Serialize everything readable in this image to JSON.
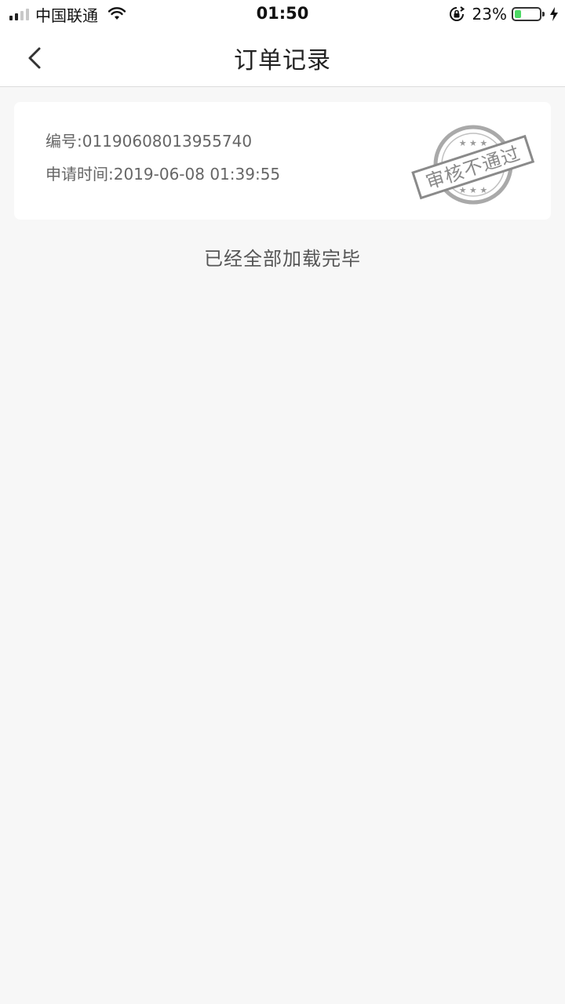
{
  "status_bar": {
    "carrier": "中国联通",
    "time": "01:50",
    "battery_percent": "23%",
    "battery_level": 0.23,
    "icons": [
      "signal-icon",
      "wifi-icon",
      "rotation-lock-icon",
      "battery-icon",
      "charging-bolt-icon"
    ]
  },
  "nav": {
    "title": "订单记录",
    "back_icon": "chevron-left-icon"
  },
  "orders": [
    {
      "number_label": "编号:01190608013955740",
      "time_label": "申请时间:2019-06-08 01:39:55",
      "stamp_text": "审核不通过",
      "stamp_color": "#8a8a8a"
    }
  ],
  "list_footer": "已经全部加载完毕",
  "colors": {
    "background": "#f7f7f7",
    "card": "#ffffff",
    "battery_fill": "#4cd964"
  }
}
